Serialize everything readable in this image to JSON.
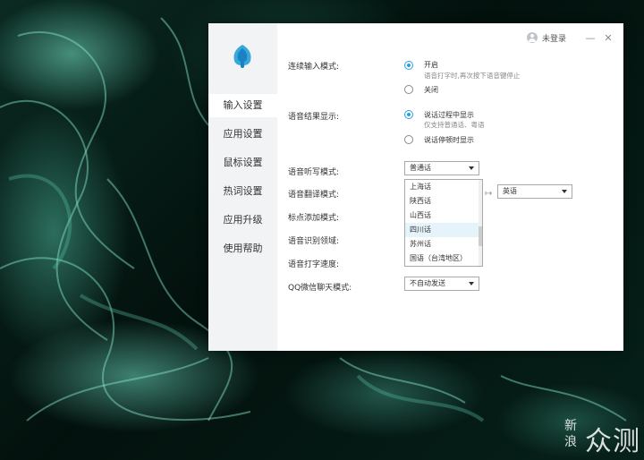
{
  "titlebar": {
    "login_label": "未登录",
    "minimize_glyph": "—",
    "close_glyph": "✕"
  },
  "sidebar": {
    "items": [
      {
        "label": "输入设置",
        "active": true
      },
      {
        "label": "应用设置",
        "active": false
      },
      {
        "label": "鼠标设置",
        "active": false
      },
      {
        "label": "热词设置",
        "active": false
      },
      {
        "label": "应用升级",
        "active": false
      },
      {
        "label": "使用帮助",
        "active": false
      }
    ]
  },
  "settings": {
    "continuous_input": {
      "label": "连续输入模式:",
      "on_label": "开启",
      "on_desc": "语音打字时,再次按下语音键停止",
      "off_label": "关闭",
      "selected": "开启"
    },
    "result_display": {
      "label": "语音结果显示:",
      "opt1_label": "说话过程中显示",
      "opt1_desc": "仅支持普通话、粤语",
      "opt2_label": "说话停顿时显示",
      "selected": "说话过程中显示"
    },
    "dictation_mode": {
      "label": "语音听写模式:",
      "value": "普通话",
      "dropdown_options": [
        "上海话",
        "陕西话",
        "山西话",
        "四川话",
        "苏州话",
        "国语（台湾地区）"
      ],
      "hovered_option": "四川话"
    },
    "translation_mode": {
      "label": "语音翻译模式:",
      "arrow": "↦",
      "target_value": "英语"
    },
    "punctuation_mode": {
      "label": "标点添加模式:"
    },
    "recognition_domain": {
      "label": "语音识别领域:"
    },
    "typing_speed": {
      "label": "语音打字速度:"
    },
    "qq_wechat_mode": {
      "label": "QQ微信聊天模式:",
      "value": "不自动发送"
    }
  },
  "colors": {
    "accent": "#2a9fd8",
    "sidebar_bg": "#f2f3f5",
    "hover_bg": "#e5f3fb"
  },
  "watermark": {
    "small_chars": [
      "新",
      "浪"
    ],
    "big_text": "众测"
  }
}
